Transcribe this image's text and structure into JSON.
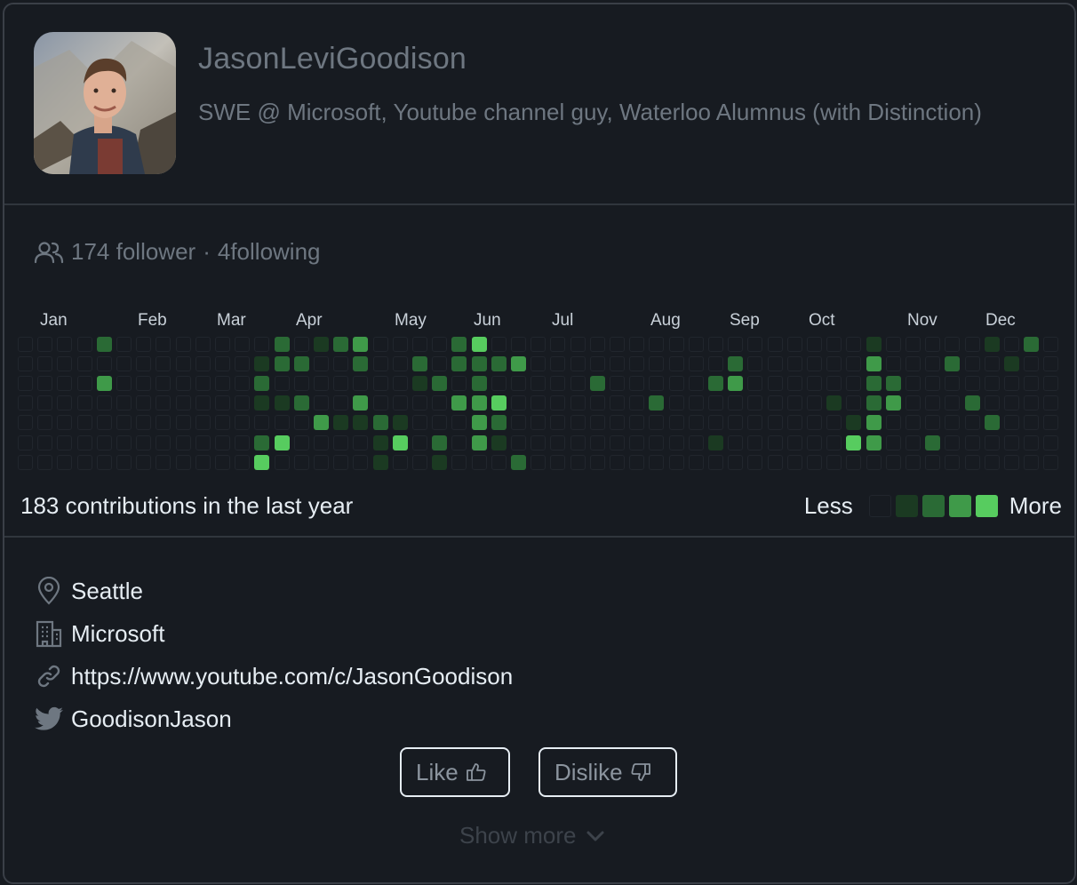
{
  "profile": {
    "username": "JasonLeviGoodison",
    "bio": "SWE @ Microsoft, Youtube channel guy, Waterloo Alumnus (with Distinction)"
  },
  "social": {
    "followers": "174 follower",
    "separator": "·",
    "following": "4following"
  },
  "contributions": {
    "months": [
      "Jan",
      "Feb",
      "Mar",
      "Apr",
      "May",
      "Jun",
      "Jul",
      "Aug",
      "Sep",
      "Oct",
      "Nov",
      "Dec"
    ],
    "summary": "183 contributions in the last year",
    "legend_less": "Less",
    "legend_more": "More",
    "level_colors": [
      "#171b21",
      "#1b3a22",
      "#2a6a35",
      "#3f9a49",
      "#57cc5f"
    ],
    "weeks": 53,
    "days": 7,
    "active_cells": [
      [
        4,
        0,
        2
      ],
      [
        4,
        2,
        3
      ],
      [
        12,
        1,
        1
      ],
      [
        12,
        2,
        2
      ],
      [
        12,
        3,
        1
      ],
      [
        12,
        5,
        2
      ],
      [
        12,
        6,
        4
      ],
      [
        13,
        0,
        2
      ],
      [
        13,
        1,
        2
      ],
      [
        13,
        3,
        1
      ],
      [
        13,
        5,
        4
      ],
      [
        14,
        1,
        2
      ],
      [
        14,
        3,
        2
      ],
      [
        15,
        0,
        1
      ],
      [
        15,
        4,
        3
      ],
      [
        16,
        0,
        2
      ],
      [
        16,
        4,
        1
      ],
      [
        17,
        0,
        3
      ],
      [
        17,
        1,
        2
      ],
      [
        17,
        3,
        3
      ],
      [
        17,
        4,
        1
      ],
      [
        18,
        4,
        2
      ],
      [
        18,
        5,
        1
      ],
      [
        18,
        6,
        1
      ],
      [
        19,
        4,
        1
      ],
      [
        19,
        5,
        4
      ],
      [
        20,
        1,
        2
      ],
      [
        20,
        2,
        1
      ],
      [
        21,
        2,
        2
      ],
      [
        21,
        5,
        2
      ],
      [
        21,
        6,
        1
      ],
      [
        22,
        0,
        2
      ],
      [
        22,
        1,
        2
      ],
      [
        22,
        3,
        3
      ],
      [
        23,
        0,
        4
      ],
      [
        23,
        1,
        2
      ],
      [
        23,
        2,
        2
      ],
      [
        23,
        3,
        3
      ],
      [
        23,
        4,
        3
      ],
      [
        23,
        5,
        3
      ],
      [
        24,
        1,
        2
      ],
      [
        24,
        3,
        4
      ],
      [
        24,
        4,
        2
      ],
      [
        24,
        5,
        1
      ],
      [
        25,
        1,
        3
      ],
      [
        25,
        6,
        2
      ],
      [
        29,
        2,
        2
      ],
      [
        32,
        3,
        2
      ],
      [
        35,
        2,
        2
      ],
      [
        35,
        5,
        1
      ],
      [
        36,
        1,
        2
      ],
      [
        36,
        2,
        3
      ],
      [
        41,
        3,
        1
      ],
      [
        42,
        4,
        1
      ],
      [
        42,
        5,
        4
      ],
      [
        43,
        0,
        1
      ],
      [
        43,
        1,
        3
      ],
      [
        43,
        2,
        2
      ],
      [
        43,
        3,
        2
      ],
      [
        43,
        4,
        3
      ],
      [
        43,
        5,
        3
      ],
      [
        44,
        2,
        2
      ],
      [
        44,
        3,
        3
      ],
      [
        46,
        5,
        2
      ],
      [
        47,
        1,
        2
      ],
      [
        48,
        3,
        2
      ],
      [
        49,
        0,
        1
      ],
      [
        49,
        4,
        2
      ],
      [
        50,
        1,
        1
      ],
      [
        51,
        0,
        2
      ]
    ]
  },
  "details": {
    "location": "Seattle",
    "company": "Microsoft",
    "website": "https://www.youtube.com/c/JasonGoodison",
    "twitter": "GoodisonJason"
  },
  "actions": {
    "like": "Like",
    "dislike": "Dislike",
    "show_more": "Show more"
  },
  "icons": {
    "followers": "people-icon",
    "location": "location-pin-icon",
    "company": "building-icon",
    "website": "link-icon",
    "twitter": "twitter-bird-icon",
    "like": "thumbs-up-icon",
    "dislike": "thumbs-down-icon",
    "show_more": "chevron-down-icon"
  }
}
